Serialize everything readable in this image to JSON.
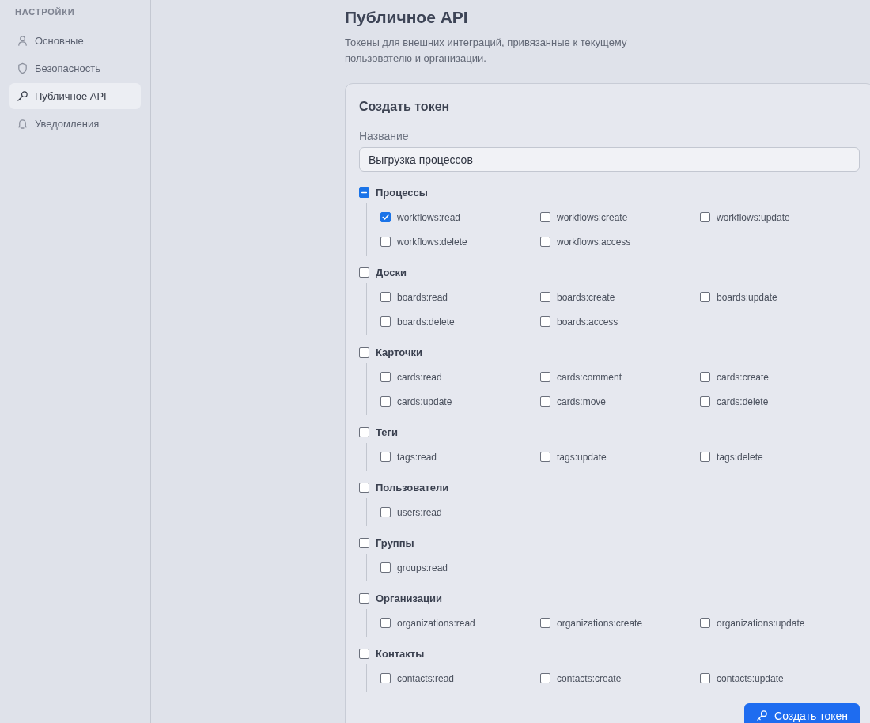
{
  "sidebar": {
    "title": "НАСТРОЙКИ",
    "items": [
      {
        "label": "Основные",
        "selected": false
      },
      {
        "label": "Безопасность",
        "selected": false
      },
      {
        "label": "Публичное API",
        "selected": true
      },
      {
        "label": "Уведомления",
        "selected": false
      }
    ]
  },
  "header": {
    "title": "Публичное API",
    "subtitle": "Токены для внешних интеграций, привязанные к текущему пользователю и организации."
  },
  "card": {
    "title": "Создать токен",
    "name_field": {
      "label": "Название",
      "value": "Выгрузка процессов"
    },
    "groups": [
      {
        "label": "Процессы",
        "indeterminate": true,
        "scopes": [
          {
            "label": "workflows:read",
            "checked": true
          },
          {
            "label": "workflows:create",
            "checked": false
          },
          {
            "label": "workflows:update",
            "checked": false
          },
          {
            "label": "workflows:delete",
            "checked": false
          },
          {
            "label": "workflows:access",
            "checked": false
          }
        ]
      },
      {
        "label": "Доски",
        "indeterminate": false,
        "scopes": [
          {
            "label": "boards:read",
            "checked": false
          },
          {
            "label": "boards:create",
            "checked": false
          },
          {
            "label": "boards:update",
            "checked": false
          },
          {
            "label": "boards:delete",
            "checked": false
          },
          {
            "label": "boards:access",
            "checked": false
          }
        ]
      },
      {
        "label": "Карточки",
        "indeterminate": false,
        "scopes": [
          {
            "label": "cards:read",
            "checked": false
          },
          {
            "label": "cards:comment",
            "checked": false
          },
          {
            "label": "cards:create",
            "checked": false
          },
          {
            "label": "cards:update",
            "checked": false
          },
          {
            "label": "cards:move",
            "checked": false
          },
          {
            "label": "cards:delete",
            "checked": false
          }
        ]
      },
      {
        "label": "Теги",
        "indeterminate": false,
        "scopes": [
          {
            "label": "tags:read",
            "checked": false
          },
          {
            "label": "tags:update",
            "checked": false
          },
          {
            "label": "tags:delete",
            "checked": false
          }
        ]
      },
      {
        "label": "Пользователи",
        "indeterminate": false,
        "scopes": [
          {
            "label": "users:read",
            "checked": false
          }
        ]
      },
      {
        "label": "Группы",
        "indeterminate": false,
        "scopes": [
          {
            "label": "groups:read",
            "checked": false
          }
        ]
      },
      {
        "label": "Организации",
        "indeterminate": false,
        "scopes": [
          {
            "label": "organizations:read",
            "checked": false
          },
          {
            "label": "organizations:create",
            "checked": false
          },
          {
            "label": "organizations:update",
            "checked": false
          }
        ]
      },
      {
        "label": "Контакты",
        "indeterminate": false,
        "scopes": [
          {
            "label": "contacts:read",
            "checked": false
          },
          {
            "label": "contacts:create",
            "checked": false
          },
          {
            "label": "contacts:update",
            "checked": false
          }
        ]
      }
    ],
    "submit": "Создать токен"
  }
}
